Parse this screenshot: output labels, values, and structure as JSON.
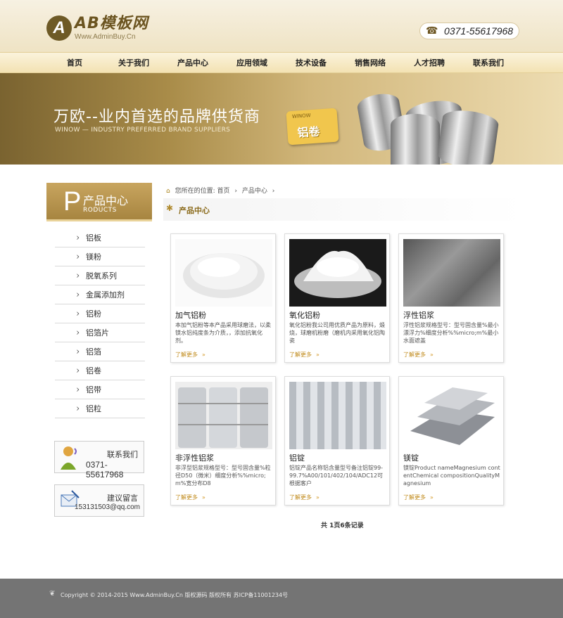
{
  "header": {
    "logo_letter": "A",
    "logo_title": "AB模板网",
    "logo_subtitle": "Www.AdminBuy.Cn",
    "phone_icon": "telephone-icon",
    "phone": "0371-55617968"
  },
  "nav": [
    "首页",
    "关于我们",
    "产品中心",
    "应用领域",
    "技术设备",
    "销售网络",
    "人才招聘",
    "联系我们"
  ],
  "banner": {
    "title": "万欧--业内首选的品牌供货商",
    "subtitle": "WINOW — INDUSTRY PREFERRED BRAND SUPPLIERS",
    "badge_small": "WINOW",
    "badge_text": "铝卷"
  },
  "sidebar": {
    "head_letter": "P",
    "head_title": "产品中心",
    "head_en": "RODUCTS",
    "items": [
      "铝板",
      "镁粉",
      "脱氧系列",
      "金属添加剂",
      "铝粉",
      "铝箔片",
      "铝箔",
      "铝卷",
      "铝带",
      "铝粒"
    ],
    "contact_title": "联系我们",
    "contact_value": "0371-55617968",
    "message_title": "建议留言",
    "message_value": "153131503@qq.com"
  },
  "breadcrumb": {
    "prefix": "您所在的位置:",
    "items": [
      "首页",
      "产品中心"
    ],
    "separator": "›"
  },
  "section": {
    "title": "产品中心"
  },
  "products": [
    {
      "name": "加气铝粉",
      "desc": "本加气铝粉等本产品采用球磨法，以柔镁水铝纯度条为介质，，添加抗氧化剂。",
      "more": "了解更多",
      "arrow": "»"
    },
    {
      "name": "氧化铝粉",
      "desc": "氧化铝粉我公司用优质产品为原料，煅烧，球磨机粉磨（磨机内采用氧化铝陶瓷",
      "more": "了解更多",
      "arrow": "»"
    },
    {
      "name": "浮性铝浆",
      "desc": "浮性铝浆规格型号：型号固含量%最小漂浮力%细度分析%%micro;m%最小水面遮盖",
      "more": "了解更多",
      "arrow": "»"
    },
    {
      "name": "非浮性铝浆",
      "desc": "非浮型铝浆规格型号：型号固含量%粒径D50（微米）细度分析%%micro;m%宽分布D8",
      "more": "了解更多",
      "arrow": "»"
    },
    {
      "name": "铝锭",
      "desc": "铝锭产品名称铝含量型号备注铝锭99-99.7%A00/101/402/104/ADC12可根据客户",
      "more": "了解更多",
      "arrow": "»"
    },
    {
      "name": "镁锭",
      "desc": "镁锭Product nameMagnesium contentChemical compositionQualityMagnesium",
      "more": "了解更多",
      "arrow": "»"
    }
  ],
  "pager": "共 1页6条记录",
  "footer": {
    "icon": "hands-icon",
    "text": "Copyright © 2014-2015 Www.AdminBuy.Cn 版权源码 版权所有    苏ICP备11001234号"
  }
}
